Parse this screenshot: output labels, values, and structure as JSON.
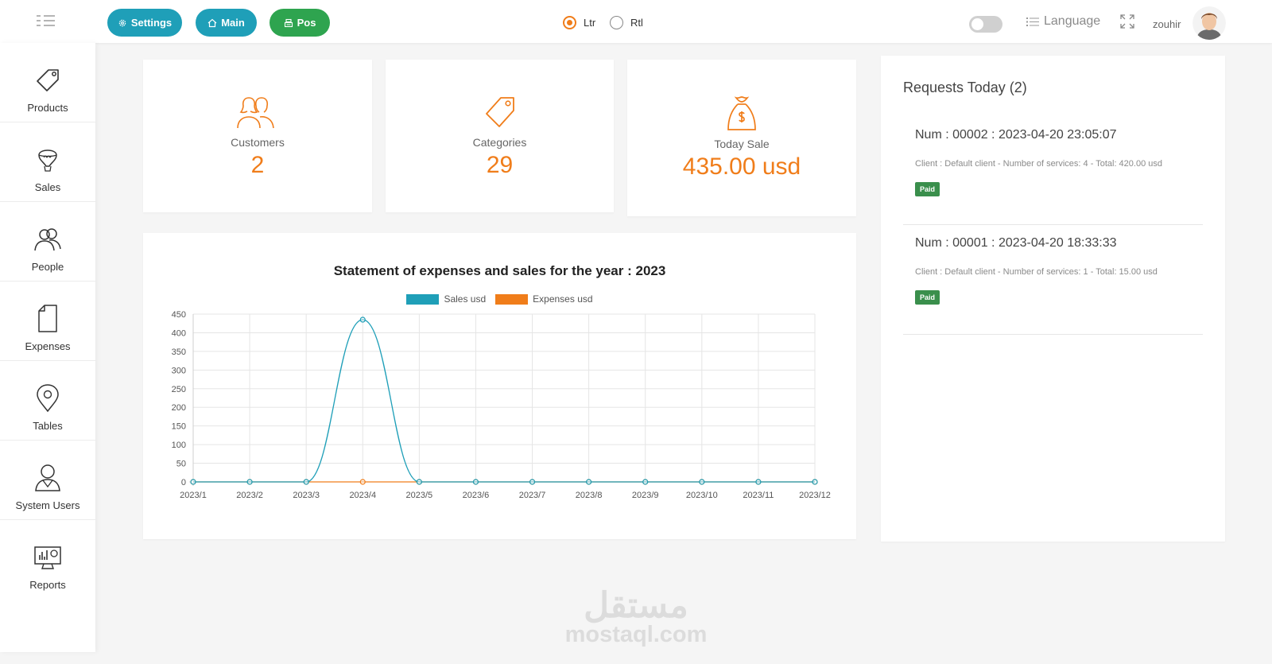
{
  "topbar": {
    "buttons": {
      "settings": "Settings",
      "main": "Main",
      "pos": "Pos"
    },
    "direction": {
      "ltr": "Ltr",
      "rtl": "Rtl",
      "selected": "Ltr"
    },
    "dark_mode": false,
    "language_label": "Language",
    "username": "zouhir"
  },
  "sidebar": {
    "items": [
      {
        "label": "Products",
        "icon": "tag-icon"
      },
      {
        "label": "Sales",
        "icon": "balloon-icon"
      },
      {
        "label": "People",
        "icon": "people-icon"
      },
      {
        "label": "Expenses",
        "icon": "document-icon"
      },
      {
        "label": "Tables",
        "icon": "location-pin-icon"
      },
      {
        "label": "System Users",
        "icon": "user-icon"
      },
      {
        "label": "Reports",
        "icon": "monitor-chart-icon"
      }
    ]
  },
  "stats": {
    "customers": {
      "label": "Customers",
      "value": "2"
    },
    "categories": {
      "label": "Categories",
      "value": "29"
    },
    "today_sale": {
      "label": "Today Sale",
      "value": "435.00 usd"
    }
  },
  "colors": {
    "accent": "#f07d1a",
    "teal": "#1f9fb8",
    "green": "#2ea44f",
    "paid": "#3a8f4c"
  },
  "chart_data": {
    "type": "line",
    "title": "Statement of expenses and sales for the year : 2023",
    "categories": [
      "2023/1",
      "2023/2",
      "2023/3",
      "2023/4",
      "2023/5",
      "2023/6",
      "2023/7",
      "2023/8",
      "2023/9",
      "2023/10",
      "2023/11",
      "2023/12"
    ],
    "series": [
      {
        "name": "Sales usd",
        "color": "#1f9fb8",
        "values": [
          0,
          0,
          0,
          435,
          0,
          0,
          0,
          0,
          0,
          0,
          0,
          0
        ]
      },
      {
        "name": "Expenses usd",
        "color": "#f07d1a",
        "values": [
          0,
          0,
          0,
          0,
          0,
          0,
          0,
          0,
          0,
          0,
          0,
          0
        ]
      }
    ],
    "yticks": [
      0,
      50,
      100,
      150,
      200,
      250,
      300,
      350,
      400,
      450
    ],
    "ylim": [
      0,
      450
    ],
    "grid": true,
    "legend": "top-center"
  },
  "requests": {
    "title": "Requests Today (2)",
    "items": [
      {
        "num": "Num : 00002 : 2023-04-20 23:05:07",
        "desc": "Client : Default client - Number of services: 4 - Total: 420.00 usd",
        "status": "Paid"
      },
      {
        "num": "Num : 00001 : 2023-04-20 18:33:33",
        "desc": "Client : Default client - Number of services: 1 - Total: 15.00 usd",
        "status": "Paid"
      }
    ]
  },
  "watermark": {
    "logo": "مستقل",
    "domain": "mostaql.com"
  }
}
